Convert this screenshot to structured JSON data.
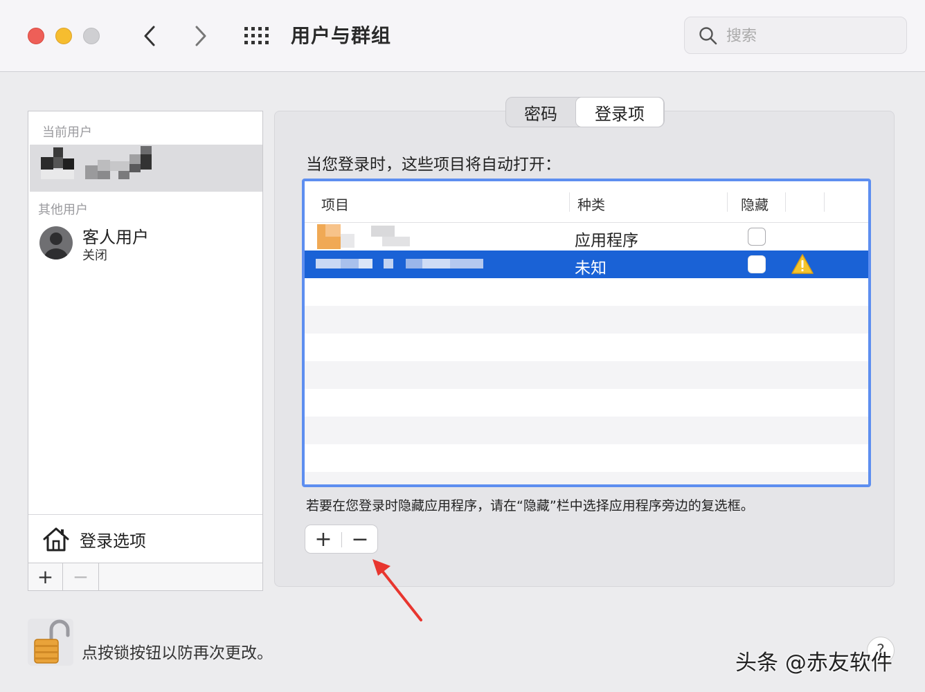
{
  "window": {
    "title": "用户与群组"
  },
  "search": {
    "placeholder": "搜索"
  },
  "sidebar": {
    "current_user_label": "当前用户",
    "other_users_label": "其他用户",
    "guest": {
      "name": "客人用户",
      "status": "关闭"
    },
    "login_options_label": "登录选项",
    "add_label": "+",
    "remove_label": "−"
  },
  "tabs": [
    {
      "label": "密码",
      "selected": false
    },
    {
      "label": "登录项",
      "selected": true
    }
  ],
  "main": {
    "description": "当您登录时，这些项目将自动打开：",
    "columns": [
      "项目",
      "种类",
      "隐藏"
    ],
    "rows": [
      {
        "kind": "应用程序",
        "hidden": false,
        "selected": false,
        "warning": false
      },
      {
        "kind": "未知",
        "hidden": false,
        "selected": true,
        "warning": true
      }
    ],
    "note": "若要在您登录时隐藏应用程序，请在“隐藏”栏中选择应用程序旁边的复选框。",
    "add_label": "+",
    "remove_label": "−"
  },
  "footer": {
    "lock_text": "点按锁按钮以防再次更改。",
    "help_label": "?",
    "watermark": "头条 @赤友软件"
  },
  "colors": {
    "selection": "#1a62d6",
    "table_focus_border": "#5d8ef0",
    "close": "#ee5f58",
    "minimize": "#f6bd2f",
    "arrow": "#e8362f",
    "warning": "#f5c52e"
  }
}
